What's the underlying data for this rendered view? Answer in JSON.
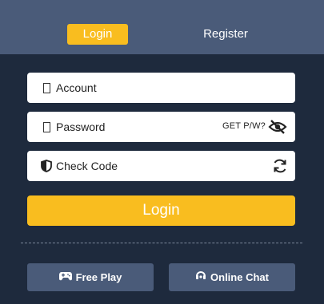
{
  "tabs": {
    "login_label": "Login",
    "register_label": "Register"
  },
  "form": {
    "account_placeholder": "Account",
    "password_placeholder": "Password",
    "get_password_label": "GET P/W?",
    "check_code_placeholder": "Check Code",
    "submit_label": "Login"
  },
  "actions": {
    "free_play_label": "Free Play",
    "online_chat_label": "Online Chat"
  },
  "colors": {
    "accent": "#f9bd1f",
    "header_bg": "#4a5b79",
    "page_bg": "#1e2a3d"
  },
  "icons": {
    "account": "user-icon",
    "password": "lock-icon",
    "check_code": "shield-icon",
    "toggle_visibility": "eye-slash-icon",
    "refresh": "refresh-icon",
    "free_play": "gamepad-icon",
    "online_chat": "headset-icon"
  }
}
